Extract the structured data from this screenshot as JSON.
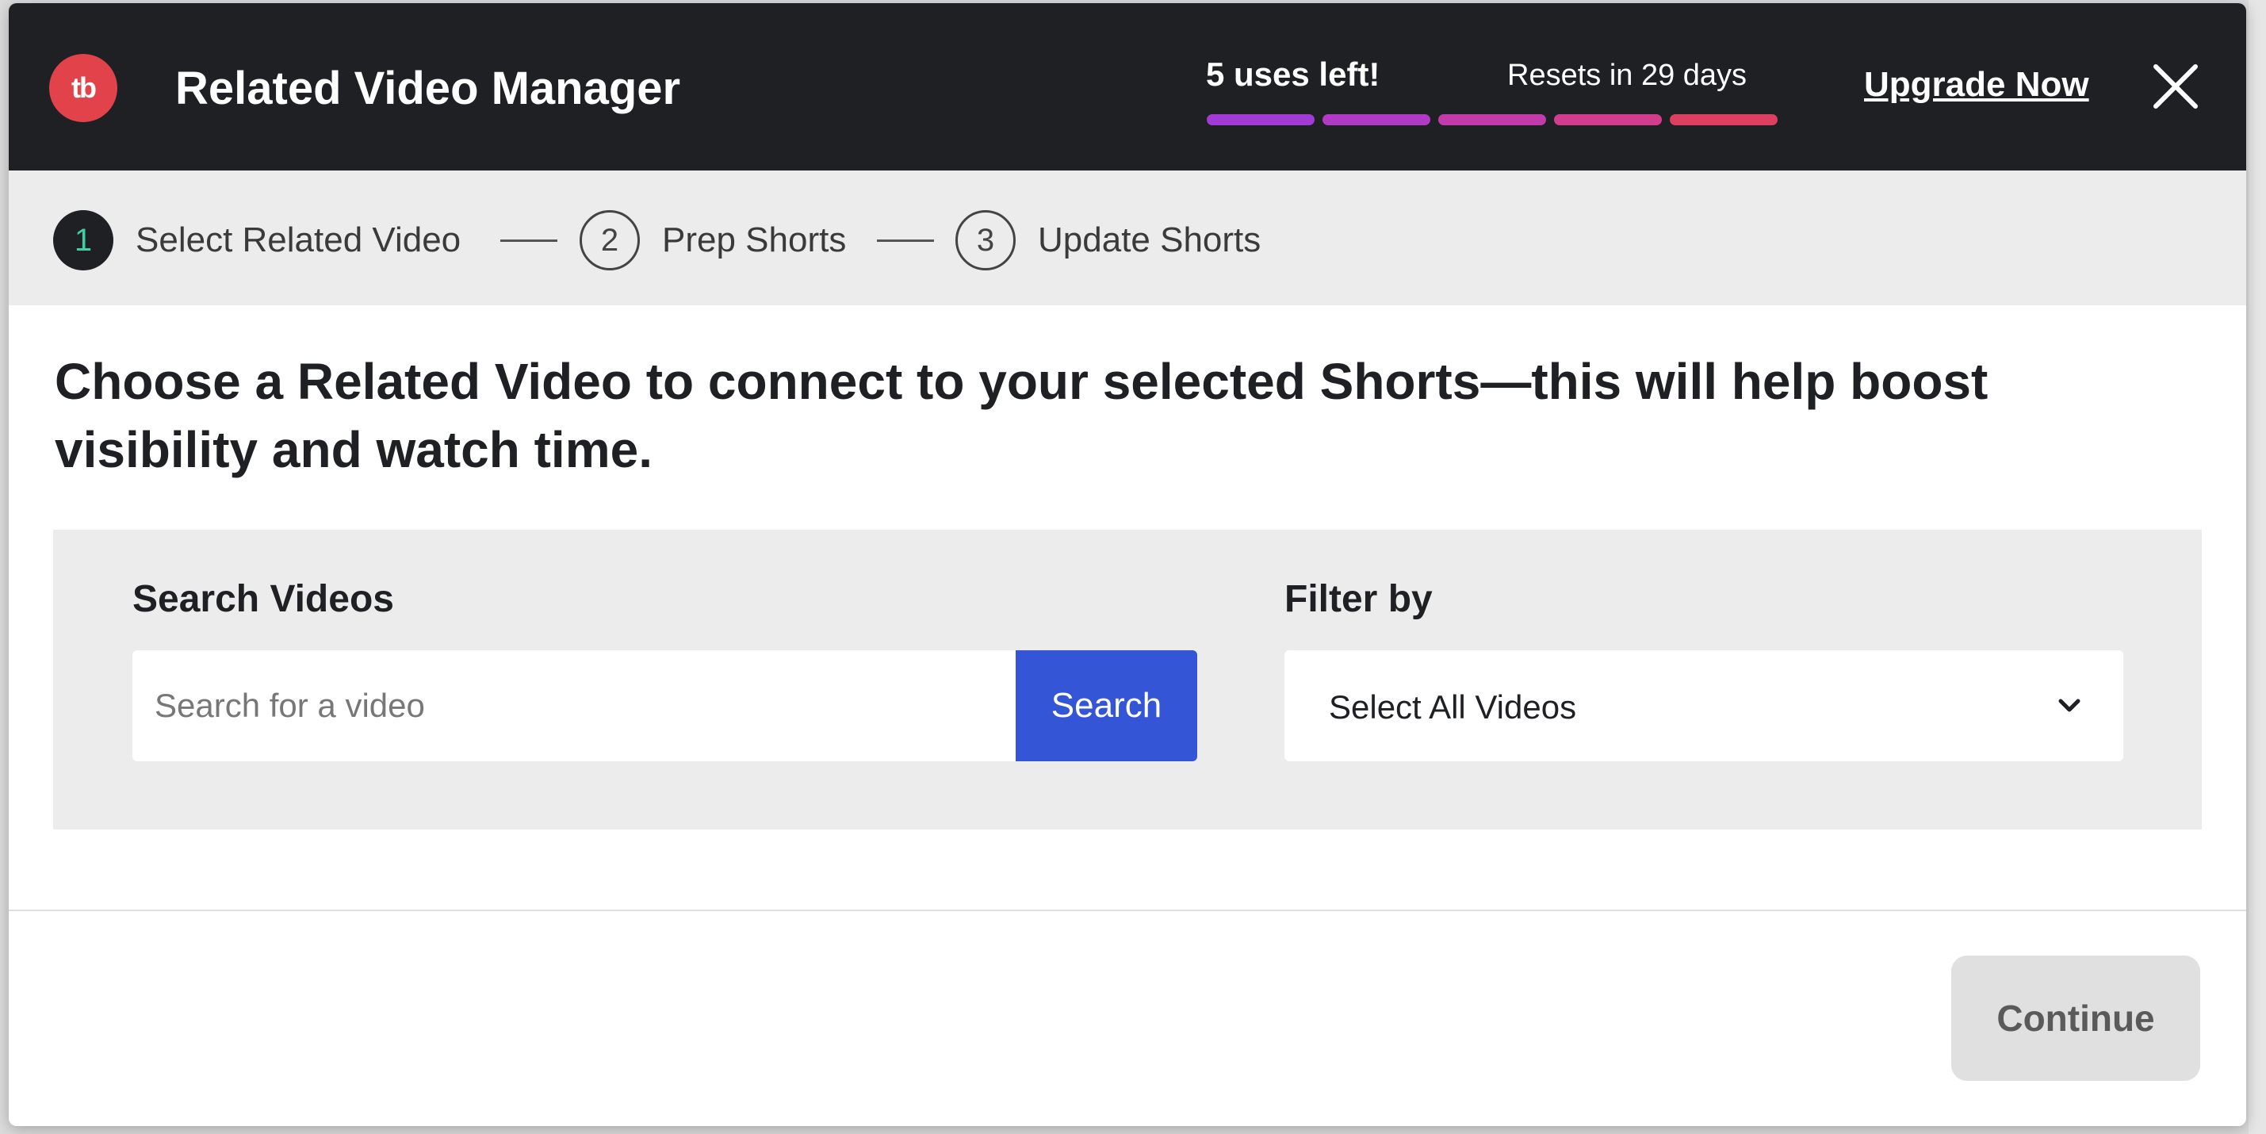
{
  "header": {
    "logo_text": "tb",
    "title": "Related Video Manager",
    "uses_left": "5 uses left!",
    "resets": "Resets in 29 days",
    "upgrade_label": "Upgrade Now",
    "usage_segments": [
      "#a23ad6",
      "#b13ac5",
      "#c23bab",
      "#d13d8c",
      "#dc3f5f"
    ],
    "close_icon": "close-icon"
  },
  "stepper": {
    "steps": [
      {
        "number": "1",
        "label": "Select Related Video",
        "state": "active"
      },
      {
        "number": "2",
        "label": "Prep Shorts",
        "state": "inactive"
      },
      {
        "number": "3",
        "label": "Update Shorts",
        "state": "inactive"
      }
    ]
  },
  "main": {
    "instructions": "Choose a Related Video to connect to your selected Shorts—this will help boost visibility and watch time."
  },
  "search": {
    "label": "Search Videos",
    "placeholder": "Search for a video",
    "value": "",
    "button_label": "Search"
  },
  "filter": {
    "label": "Filter by",
    "selected": "Select All Videos",
    "icon": "chevron-down-icon"
  },
  "footer": {
    "continue_label": "Continue"
  },
  "colors": {
    "header_bg": "#1f2024",
    "logo": "#e2434b",
    "search_button": "#3355d6",
    "active_step_number": "#3fd1a3"
  }
}
